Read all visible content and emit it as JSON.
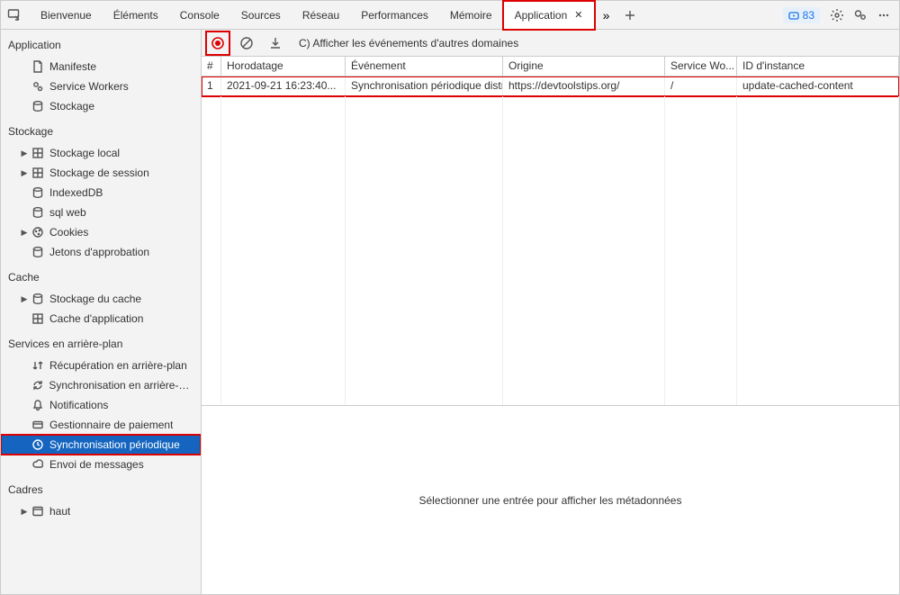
{
  "tabs": {
    "items": [
      "Bienvenue",
      "Éléments",
      "Console",
      "Sources",
      "Réseau",
      "Performances",
      "Mémoire",
      "Application"
    ],
    "active": "Application"
  },
  "badge": "83",
  "sidebar": {
    "section_application": "Application",
    "app_items": [
      "Manifeste",
      "Service Workers",
      "Stockage"
    ],
    "section_storage": "Stockage",
    "storage_items": [
      "Stockage local",
      "Stockage de session",
      "IndexedDB",
      "sql web",
      "Cookies",
      "Jetons d'approbation"
    ],
    "section_cache": "Cache",
    "cache_items": [
      "Stockage du cache",
      "Cache d'application"
    ],
    "section_bg": "Services en arrière-plan",
    "bg_items": [
      "Récupération en arrière-plan",
      "Synchronisation en arrière-plan",
      "Notifications",
      "Gestionnaire de paiement",
      "Synchronisation périodique",
      "Envoi de messages"
    ],
    "section_frames": "Cadres",
    "frames_items": [
      "haut"
    ]
  },
  "toolbar": {
    "other_domains": "C) Afficher les événements d'autres domaines"
  },
  "table": {
    "headers": [
      "#",
      "Horodatage",
      "Événement",
      "Origine",
      "Service Wo...",
      "ID d'instance"
    ],
    "row": {
      "n": "1",
      "timestamp": "2021-09-21 16:23:40...",
      "event": "Synchronisation périodique distribuée...",
      "origin": "https://devtoolstips.org/",
      "sw": "/",
      "instance": "update-cached-content"
    }
  },
  "detail_placeholder": "Sélectionner une entrée pour afficher les métadonnées"
}
